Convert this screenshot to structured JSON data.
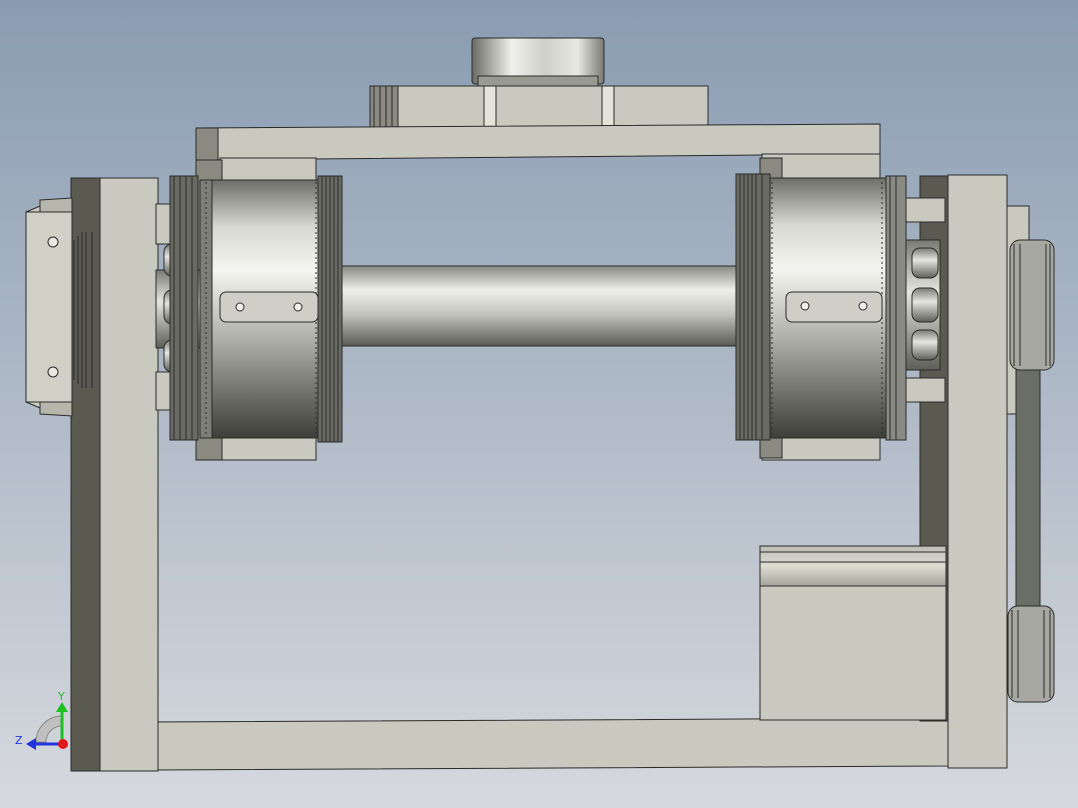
{
  "viewport": {
    "background_top": "#8a9cb2",
    "background_bottom": "#d6d9de"
  },
  "colors": {
    "plate_face": "#c9c9bf",
    "plate_side": "#5a5a50",
    "plate_edge": "#2a2a2a",
    "metal_light": "#f2f2ee",
    "metal_mid": "#a8a8a2",
    "metal_dark": "#3e3e3a",
    "belt": "#6b6e66"
  },
  "triad": {
    "y_label": "Y",
    "z_label": "Z",
    "y_color": "#19c21d",
    "z_color": "#2233dd",
    "x_color": "#e01818"
  }
}
